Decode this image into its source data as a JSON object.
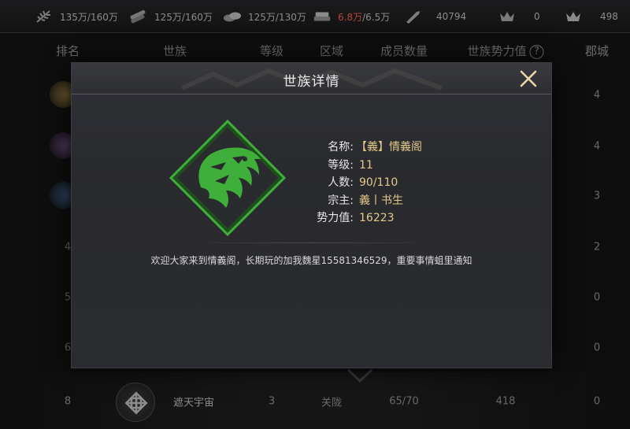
{
  "resources": [
    {
      "icon": "feather-icon",
      "value": "135万/160万",
      "warn_part": "",
      "rest": ""
    },
    {
      "icon": "wood-icon",
      "value": "125万/160万",
      "warn_part": "",
      "rest": ""
    },
    {
      "icon": "stone-icon",
      "value": "125万/130万",
      "warn_part": "",
      "rest": ""
    },
    {
      "icon": "iron-icon",
      "value": "",
      "warn_part": "6.8万",
      "rest": "/6.5万"
    },
    {
      "icon": "blade-icon",
      "value": "40794",
      "warn_part": "",
      "rest": ""
    },
    {
      "icon": "crown-icon",
      "value": "0",
      "warn_part": "",
      "rest": ""
    },
    {
      "icon": "gold-crown-icon",
      "value": "498",
      "warn_part": "",
      "rest": ""
    }
  ],
  "table": {
    "headers": {
      "rank": "排名",
      "clan": "世族",
      "level": "等级",
      "region": "区域",
      "members": "成员数量",
      "power": "世族势力值",
      "help": "?",
      "cities": "郡城"
    },
    "left_ranks": [
      "4",
      "5",
      "6"
    ],
    "right_cities": [
      "4",
      "4",
      "3",
      "2",
      "0",
      "0",
      "0"
    ],
    "last_row": {
      "rank": "8",
      "name": "遮天宇宙",
      "level": "3",
      "region": "关陇",
      "members": "65/70",
      "power": "418",
      "cities": "0"
    }
  },
  "modal": {
    "title": "世族详情",
    "fields": [
      {
        "label": "名称:",
        "value": "【義】情義阁"
      },
      {
        "label": "等级:",
        "value": "11"
      },
      {
        "label": "人数:",
        "value": "90/110"
      },
      {
        "label": "宗主:",
        "value": "義丨书生"
      },
      {
        "label": "势力值:",
        "value": "16223"
      }
    ],
    "notice": "欢迎大家来到情義阁，长期玩的加我魏星15581346529，重要事情蛆里通知"
  },
  "colors": {
    "accent_green": "#3fae3a",
    "value_gold": "#e3c98b",
    "warn_red": "#b8433a"
  }
}
